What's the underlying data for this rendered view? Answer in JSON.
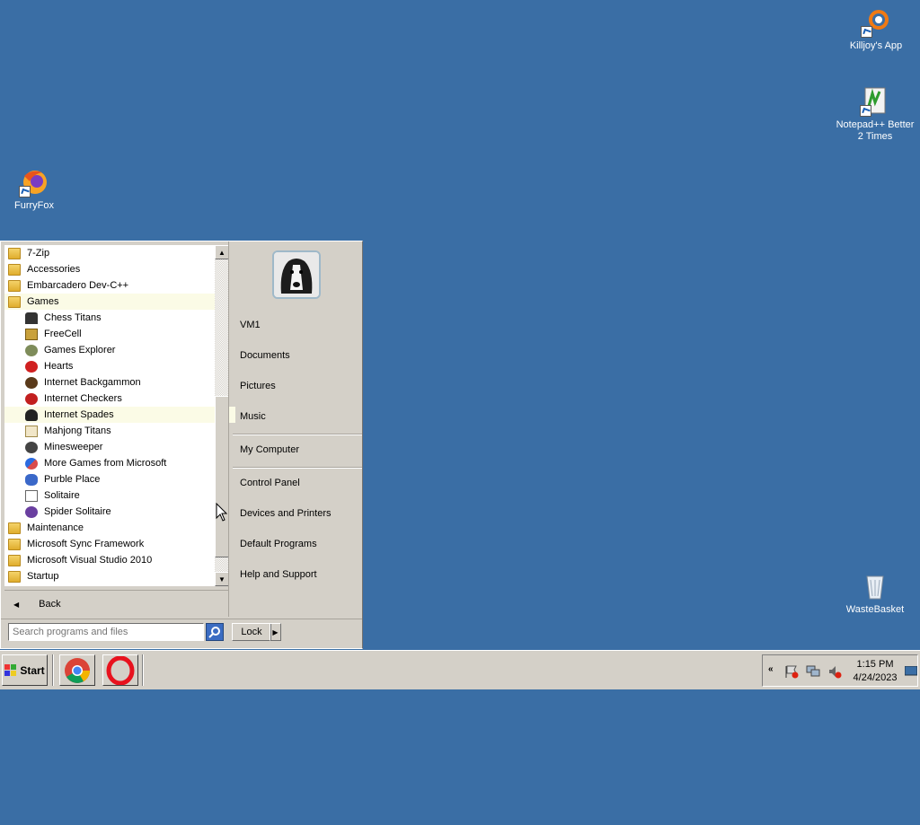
{
  "desktop": {
    "icons": [
      {
        "label": "Killjoy's App"
      },
      {
        "label": "Notepad++ Better 2 Times"
      },
      {
        "label": "FurryFox"
      },
      {
        "label": "WasteBasket"
      }
    ]
  },
  "start_menu": {
    "programs": [
      {
        "label": "7-Zip",
        "type": "folder"
      },
      {
        "label": "Accessories",
        "type": "folder"
      },
      {
        "label": "Embarcadero Dev-C++",
        "type": "folder"
      },
      {
        "label": "Games",
        "type": "folder",
        "highlighted": true
      },
      {
        "label": "Chess Titans",
        "type": "app"
      },
      {
        "label": "FreeCell",
        "type": "app"
      },
      {
        "label": "Games Explorer",
        "type": "app"
      },
      {
        "label": "Hearts",
        "type": "app"
      },
      {
        "label": "Internet Backgammon",
        "type": "app"
      },
      {
        "label": "Internet Checkers",
        "type": "app"
      },
      {
        "label": "Internet Spades",
        "type": "app",
        "highlighted": true
      },
      {
        "label": "Mahjong Titans",
        "type": "app"
      },
      {
        "label": "Minesweeper",
        "type": "app"
      },
      {
        "label": "More Games from Microsoft",
        "type": "app"
      },
      {
        "label": "Purble Place",
        "type": "app"
      },
      {
        "label": "Solitaire",
        "type": "app"
      },
      {
        "label": "Spider Solitaire",
        "type": "app"
      },
      {
        "label": "Maintenance",
        "type": "folder"
      },
      {
        "label": "Microsoft Sync Framework",
        "type": "folder"
      },
      {
        "label": "Microsoft Visual Studio 2010",
        "type": "folder"
      },
      {
        "label": "Startup",
        "type": "folder"
      }
    ],
    "back_label": "Back",
    "search_placeholder": "Search programs and files",
    "lock_label": "Lock",
    "right_items": {
      "user": "VM1",
      "documents": "Documents",
      "pictures": "Pictures",
      "music": "Music",
      "computer": "My Computer",
      "control_panel": "Control Panel",
      "devices": "Devices and Printers",
      "default_programs": "Default Programs",
      "help": "Help and Support"
    }
  },
  "taskbar": {
    "start_label": "Start",
    "clock_time": "1:15 PM",
    "clock_date": "4/24/2023"
  },
  "colors": {
    "desktop": "#3a6ea5",
    "chrome_face": "#d4d0c8",
    "highlight": "#fbfbe6"
  }
}
